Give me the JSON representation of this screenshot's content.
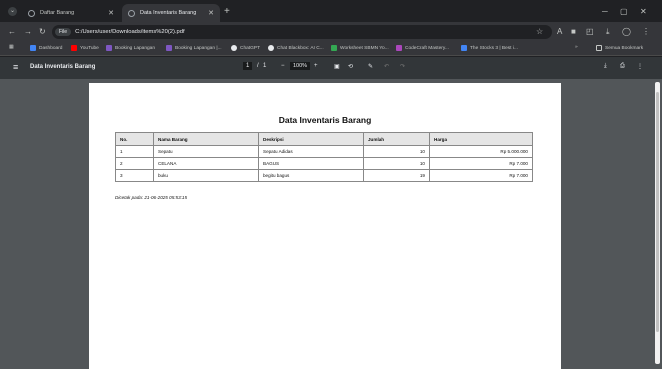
{
  "browser": {
    "tabs": [
      {
        "title": "Daftar Barang",
        "active": false
      },
      {
        "title": "Data Inventaris Barang",
        "active": true
      }
    ],
    "url_chip": "File",
    "url": "C:/Users/user/Downloads/items%20(2).pdf",
    "bookmarks": [
      {
        "label": "Dashboard",
        "color": "#4285f4"
      },
      {
        "label": "YouTube",
        "color": "#ff0000"
      },
      {
        "label": "Booking Lapangan",
        "color": "#7e57c2"
      },
      {
        "label": "Booking Lapangan |...",
        "color": "#7e57c2"
      },
      {
        "label": "ChatGPT",
        "color": "#e8eaed"
      },
      {
        "label": "Chat Blackbox: AI C...",
        "color": "#e8eaed"
      },
      {
        "label": "Worksheet SBMN Yo...",
        "color": "#34a853"
      },
      {
        "label": "CodeCraft Mastery...",
        "color": "#ab47bc"
      },
      {
        "label": "The Stocks 3 | Best i...",
        "color": "#4285f4"
      }
    ],
    "all_bookmarks": "Semua Bookmark"
  },
  "pdf": {
    "title": "Data Inventaris Barang",
    "page_current": "1",
    "page_sep": "/",
    "page_total": "1",
    "zoom": "100%"
  },
  "document": {
    "title": "Data Inventaris Barang",
    "headers": [
      "No.",
      "Nama Barang",
      "Deskripsi",
      "Jumlah",
      "Harga"
    ],
    "rows": [
      [
        "1",
        "Sepatu",
        "Sepatu Adidas",
        "10",
        "Rp 5.000.000"
      ],
      [
        "2",
        "CELANA",
        "BAGUS",
        "10",
        "Rp 7.000"
      ],
      [
        "3",
        "buku",
        "begitu bagus",
        "19",
        "Rp 7.000"
      ]
    ],
    "printed_at": "Dicetak pada: 21-06-2025 05:53:15"
  }
}
